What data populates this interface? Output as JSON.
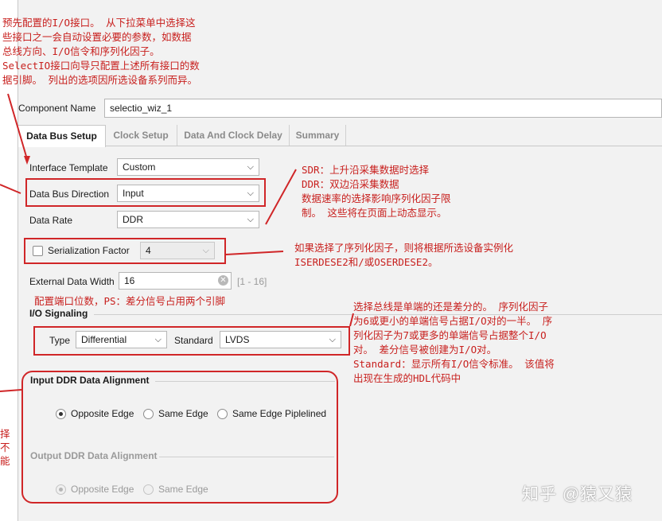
{
  "annotations": {
    "top_note": [
      "预先配置的I/O接口。 从下拉菜单中选择这",
      "些接口之一会自动设置必要的参数，如数据",
      "总线方向、I/O信令和序列化因子。",
      "SelectIO接口向导只配置上述所有接口的数",
      "据引脚。 列出的选项因所选设备系列而异。"
    ],
    "sdr_note": [
      "SDR：上升沿采集数据时选择",
      "DDR：双边沿采集数据",
      "数据速率的选择影响序列化因子限",
      "制。 这些将在页面上动态显示。"
    ],
    "serial_note": [
      "如果选择了序列化因子，则将根据所选设备实例化",
      "ISERDESE2和/或OSERDESE2。"
    ],
    "width_note": "配置端口位数，PS：差分信号占用两个引脚",
    "iosig_note": [
      "选择总线是单端的还是差分的。 序列化因子",
      "为6或更小的单端信号占据I/O对的一半。 序",
      "列化因子为7或更多的单端信号占据整个I/O",
      "对。 差分信号被创建为I/O对。",
      "Standard：显示所有I/O信令标准。 该值将",
      "出现在生成的HDL代码中"
    ],
    "left_fragments": [
      "择",
      "不",
      "能"
    ]
  },
  "component": {
    "label": "Component Name",
    "value": "selectio_wiz_1"
  },
  "tabs": [
    "Data Bus Setup",
    "Clock Setup",
    "Data And Clock Delay",
    "Summary"
  ],
  "form": {
    "interface_template": {
      "label": "Interface Template",
      "value": "Custom"
    },
    "data_bus_direction": {
      "label": "Data Bus Direction",
      "value": "Input"
    },
    "data_rate": {
      "label": "Data Rate",
      "value": "DDR"
    },
    "serialization": {
      "label": "Serialization Factor",
      "value": "4",
      "checked": false
    },
    "external_width": {
      "label": "External Data Width",
      "value": "16",
      "range": "[1 - 16]"
    }
  },
  "io_signaling": {
    "title": "I/O Signaling",
    "type_label": "Type",
    "type_value": "Differential",
    "standard_label": "Standard",
    "standard_value": "LVDS"
  },
  "input_ddr": {
    "title": "Input DDR Data Alignment",
    "options": [
      "Opposite Edge",
      "Same Edge",
      "Same Edge Piplelined"
    ],
    "selected": 0
  },
  "output_ddr": {
    "title": "Output DDR Data Alignment",
    "options": [
      "Opposite Edge",
      "Same Edge"
    ],
    "selected": 0
  },
  "watermark": "知乎 @猿又猿",
  "colors": {
    "annotation": "#c8201e",
    "box": "#d02628",
    "panel": "#f2f2f2"
  }
}
